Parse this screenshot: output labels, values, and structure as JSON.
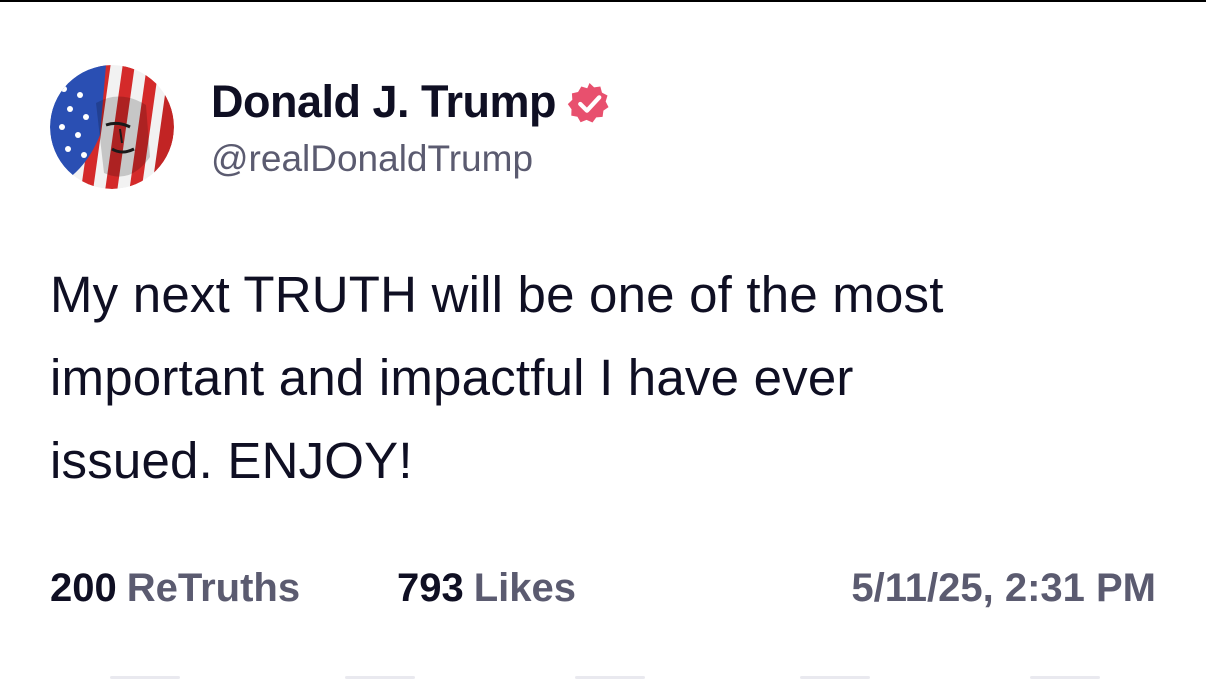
{
  "post": {
    "author": {
      "display_name": "Donald J. Trump",
      "handle": "@realDonaldTrump",
      "verified": true,
      "verified_color": "#e8506e"
    },
    "text": "My next TRUTH will be one of the most\nimportant and impactful I have ever\nissued. ENJOY!",
    "stats": {
      "retruths_count": "200",
      "retruths_label": "ReTruths",
      "likes_count": "793",
      "likes_label": "Likes"
    },
    "timestamp": "5/11/25, 2:31 PM"
  },
  "colors": {
    "primary_text": "#0f0f23",
    "secondary_text": "#5b5b70",
    "background": "#ffffff"
  }
}
